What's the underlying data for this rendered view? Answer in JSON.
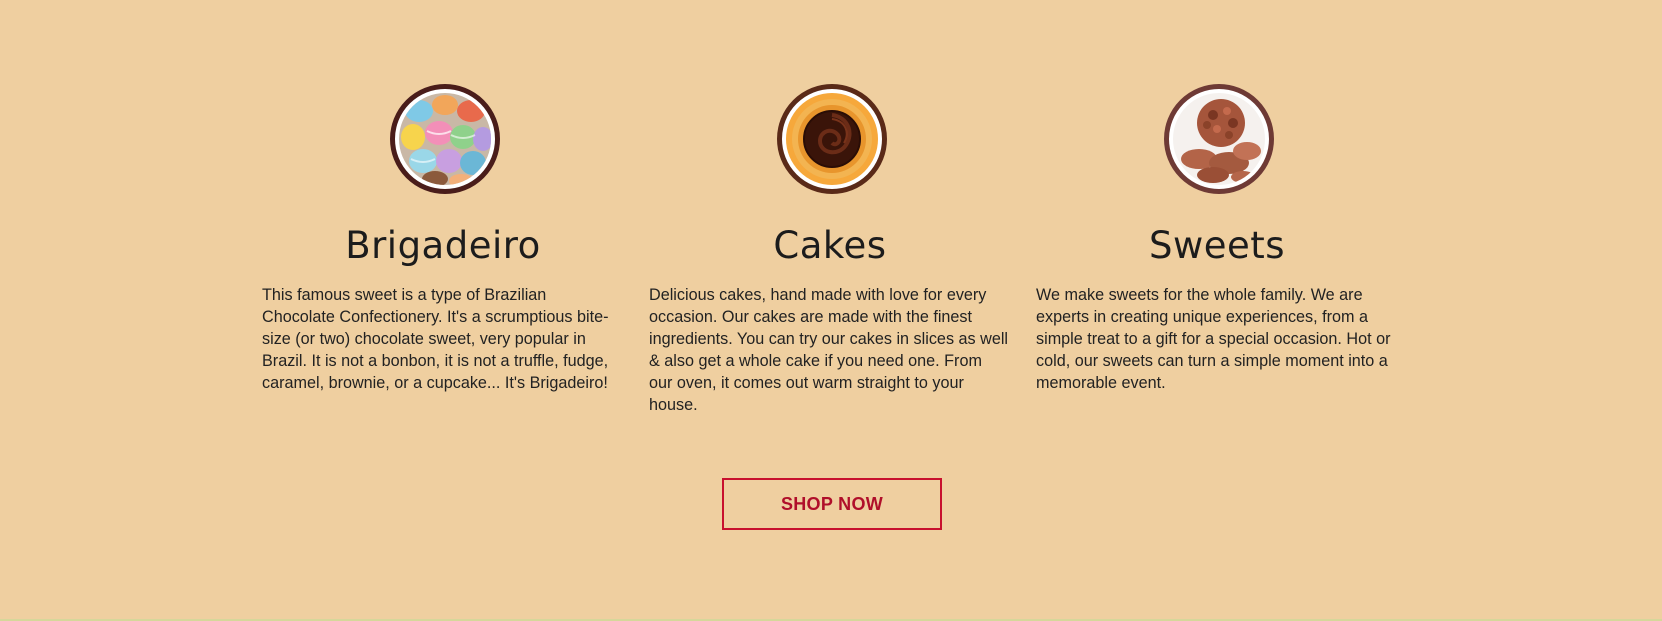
{
  "features": [
    {
      "icon": "macarons-image",
      "title": "Brigadeiro",
      "description": "This famous sweet is a type of Brazilian Chocolate Confectionery. It's a scrumptious bite-size (or two) chocolate sweet, very popular in Brazil. It is not a bonbon, it is not a truffle, fudge, caramel, brownie, or a cupcake... It's Brigadeiro!"
    },
    {
      "icon": "chocolate-cake-image",
      "title": "Cakes",
      "description": "Delicious cakes, hand made with love for every occasion. Our cakes are made with the finest ingredients. You can try our cakes in slices as well & also get a whole cake if you need one. From our oven, it comes out warm straight to your house."
    },
    {
      "icon": "chocolate-truffles-image",
      "title": "Sweets",
      "description": "We make sweets for the whole family. We are experts in creating unique experiences, from a simple treat to a gift for a special occasion. Hot or cold, our sweets can turn a simple moment into a memorable event."
    }
  ],
  "cta": {
    "label": "SHOP NOW"
  },
  "colors": {
    "background": "#EFCFA0",
    "accent": "#C8102E",
    "ring": "#4A1D1A"
  }
}
